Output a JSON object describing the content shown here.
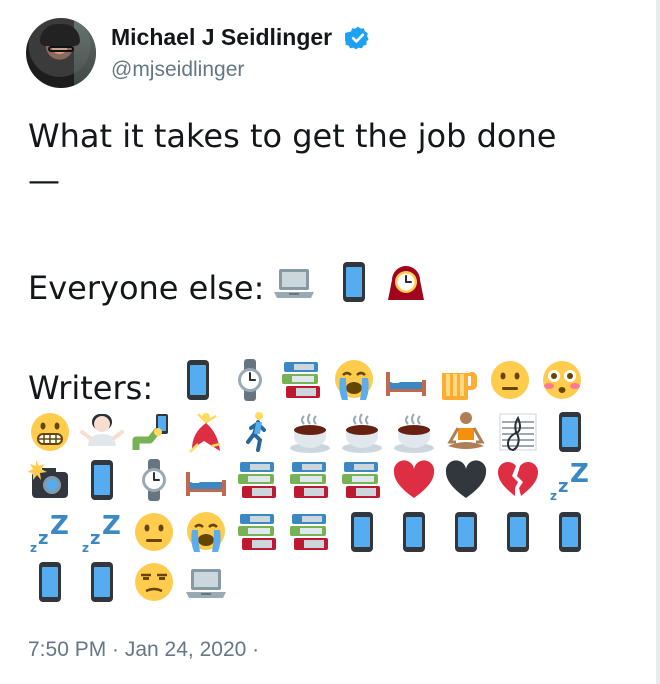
{
  "author": {
    "name": "Michael J Seidlinger",
    "handle": "@mjseidlinger",
    "verified": true,
    "avatar": "avatar"
  },
  "tweet": {
    "line1": "What it takes to get the job done",
    "line2": "—",
    "everyone_label": "Everyone else:",
    "everyone_icons": [
      "laptop-icon",
      "phone-icon",
      "mantel-clock-icon"
    ],
    "writers_label": "Writers:",
    "writers_icons": [
      [
        "phone-icon",
        "watch-icon",
        "books-icon",
        "crying-face-icon",
        "bed-icon",
        "beer-mug-icon",
        "neutral-face-icon",
        "flushed-face-icon"
      ],
      [
        "grimacing-face-icon",
        "shrugging-woman-icon",
        "selfie-icon",
        "dancer-icon",
        "runner-icon",
        "coffee-icon",
        "coffee-icon",
        "coffee-icon",
        "meditating-person-icon",
        "musical-score-icon",
        "phone-icon"
      ],
      [
        "camera-flash-icon",
        "phone-icon",
        "watch-icon",
        "bed-icon",
        "books-icon",
        "books-icon",
        "books-icon",
        "red-heart-icon",
        "black-heart-icon",
        "broken-heart-icon",
        "zzz-icon"
      ],
      [
        "zzz-icon",
        "zzz-icon",
        "neutral-face-icon",
        "crying-face-icon",
        "books-icon",
        "books-icon",
        "phone-icon",
        "phone-icon",
        "phone-icon",
        "phone-icon",
        "phone-icon"
      ],
      [
        "phone-icon",
        "phone-icon",
        "unamused-face-icon",
        "laptop-icon"
      ]
    ]
  },
  "meta": {
    "timestamp": "7:50 PM · Jan 24, 2020 ·"
  },
  "colors": {
    "verified": "#1da1f2",
    "secondary_text": "#657786",
    "primary_text": "#14171a",
    "phone_screen": "#55acee"
  }
}
